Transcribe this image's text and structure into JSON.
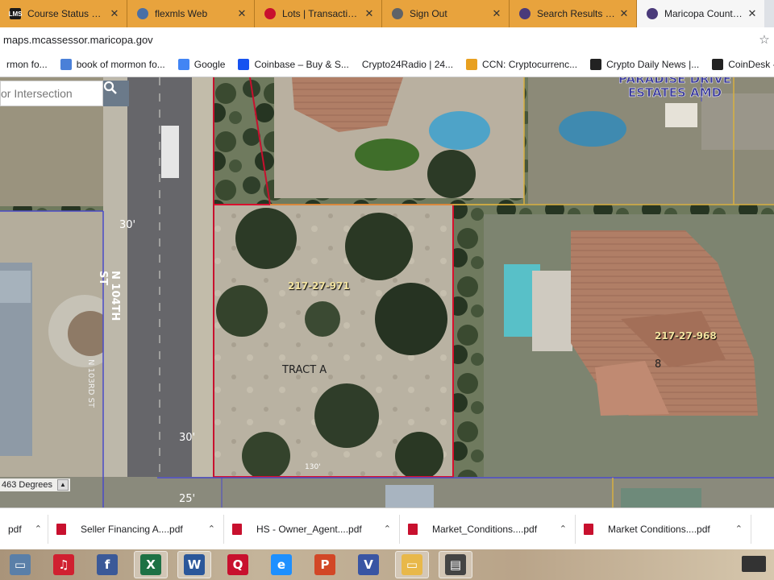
{
  "tabs": [
    {
      "title": "Course Status – EZA",
      "icon": "lms-icon",
      "color": "#1a1a1a",
      "glyph": "LMS"
    },
    {
      "title": "flexmls Web",
      "icon": "flexmls-icon",
      "color": "#4a6fa5",
      "glyph": ""
    },
    {
      "title": "Lots | TransactionDesk",
      "icon": "transactiondesk-icon",
      "color": "#c8102e",
      "glyph": ""
    },
    {
      "title": "Sign Out",
      "icon": "globe-icon",
      "color": "#5f6368",
      "glyph": ""
    },
    {
      "title": "Search Results - Maricopa",
      "icon": "maricopa-seal-icon",
      "color": "#4a3a7a",
      "glyph": ""
    },
    {
      "title": "Maricopa County Assessor",
      "icon": "maricopa-seal-icon",
      "color": "#4a3a7a",
      "glyph": ""
    }
  ],
  "address": {
    "url": "maps.mcassessor.maricopa.gov"
  },
  "bookmarks": [
    {
      "label": "rmon fo...",
      "icon": "",
      "color": ""
    },
    {
      "label": "book of mormon fo...",
      "icon": "search-icon",
      "color": "#4a80d8"
    },
    {
      "label": "Google",
      "icon": "google-icon",
      "color": "#4285f4"
    },
    {
      "label": "Coinbase – Buy & S...",
      "icon": "coinbase-icon",
      "color": "#1652f0"
    },
    {
      "label": "Crypto24Radio | 24...",
      "icon": "",
      "color": ""
    },
    {
      "label": "CCN: Cryptocurrenc...",
      "icon": "ccn-icon",
      "color": "#e8a020"
    },
    {
      "label": "Crypto Daily News |...",
      "icon": "crypto-daily-icon",
      "color": "#222222"
    },
    {
      "label": "CoinDesk - Lead",
      "icon": "coindesk-icon",
      "color": "#222222"
    }
  ],
  "map": {
    "search_placeholder": "or Intersection",
    "rotation_label": "463 Degrees",
    "labels": {
      "subdivision_line1": "PARADISE DRIVE",
      "subdivision_line2": "ESTATES AMD",
      "parcel_main": "217-27-971",
      "parcel_east": "217-27-968",
      "tract": "TRACT A",
      "street": "N 104TH ST",
      "street_west": "N 103RD ST",
      "lot_number": "8",
      "dim_30_top": "30'",
      "dim_30_bottom": "30'",
      "dim_130": "130'",
      "dim_25": "25'"
    }
  },
  "downloads": [
    {
      "label": "pdf"
    },
    {
      "label": "Seller Financing A....pdf"
    },
    {
      "label": "HS - Owner_Agent....pdf"
    },
    {
      "label": "Market_Conditions....pdf"
    },
    {
      "label": "Market Conditions....pdf"
    }
  ],
  "taskbar": [
    {
      "name": "computer-icon",
      "color": "#5a7fa8",
      "glyph": "▭"
    },
    {
      "name": "music-app-icon",
      "color": "#d02030",
      "glyph": "♫"
    },
    {
      "name": "facebook-icon",
      "color": "#3b5998",
      "glyph": "f"
    },
    {
      "name": "excel-icon",
      "color": "#1e7145",
      "glyph": "X"
    },
    {
      "name": "word-icon",
      "color": "#2b579a",
      "glyph": "W"
    },
    {
      "name": "quicken-icon",
      "color": "#c8102e",
      "glyph": "Q"
    },
    {
      "name": "internet-explorer-icon",
      "color": "#1e90ff",
      "glyph": "e"
    },
    {
      "name": "powerpoint-icon",
      "color": "#d24726",
      "glyph": "P"
    },
    {
      "name": "visio-icon",
      "color": "#3955a3",
      "glyph": "V"
    },
    {
      "name": "file-explorer-icon",
      "color": "#e8b84a",
      "glyph": "▭"
    },
    {
      "name": "printer-icon",
      "color": "#444444",
      "glyph": "▤"
    }
  ]
}
